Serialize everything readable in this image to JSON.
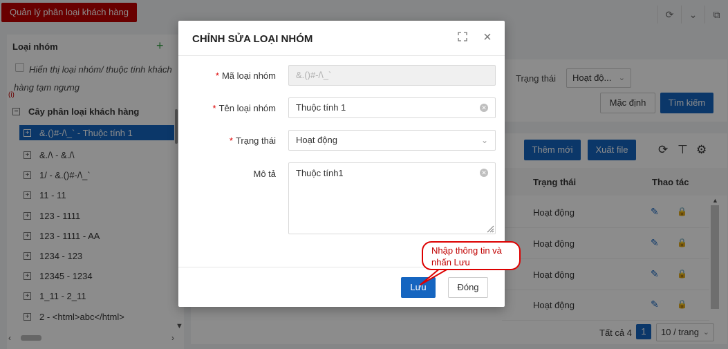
{
  "app": {
    "page_tab": "Quản lý phân loại khách hàng"
  },
  "left_panel": {
    "title": "Loại nhóm",
    "show_inactive_label": "Hiển thị loại nhóm/ thuộc tính khách hàng tạm ngưng",
    "info_mark": "(i)",
    "tree_root": "Cây phân loại khách hàng",
    "tree_items": [
      "&.()#-/\\_` - Thuộc tính 1",
      "&./\\ - &./\\",
      "1/ - &.()#-/\\_`",
      "11 - 11",
      "123 - 1111",
      "123 - 1111 - AA",
      "1234 - 123",
      "12345 - 1234",
      "1_11 - 2_11",
      "2 - <html>abc</html>"
    ]
  },
  "filter": {
    "status_label": "Trạng thái",
    "status_value": "Hoạt độ...",
    "default_button": "Mặc định",
    "search_button": "Tìm kiếm"
  },
  "table": {
    "add_button": "Thêm mới",
    "export_button": "Xuất file",
    "col_status": "Trạng thái",
    "col_actions": "Thao tác",
    "rows": [
      {
        "status": "Hoạt động"
      },
      {
        "status": "Hoạt động"
      },
      {
        "status": "Hoạt động"
      },
      {
        "status": "Hoạt động"
      }
    ],
    "pager_total": "Tất cả 4",
    "pager_page": "1",
    "pager_size": "10 / trang"
  },
  "modal": {
    "title": "CHỈNH SỬA LOẠI NHÓM",
    "code_label": "Mã loại nhóm",
    "code_value": "&.()#-/\\_`",
    "name_label": "Tên loại nhóm",
    "name_value": "Thuộc tính 1",
    "status_label": "Trạng thái",
    "status_value": "Hoạt động",
    "desc_label": "Mô tả",
    "desc_value": "Thuộc tính1",
    "required_mark": "*",
    "save_button": "Lưu",
    "close_button": "Đóng"
  },
  "callout": {
    "text": "Nhập thông tin và nhấn Lưu"
  },
  "colors": {
    "primary": "#1565c0",
    "brand_red": "#c00000",
    "required": "#dd0000"
  }
}
